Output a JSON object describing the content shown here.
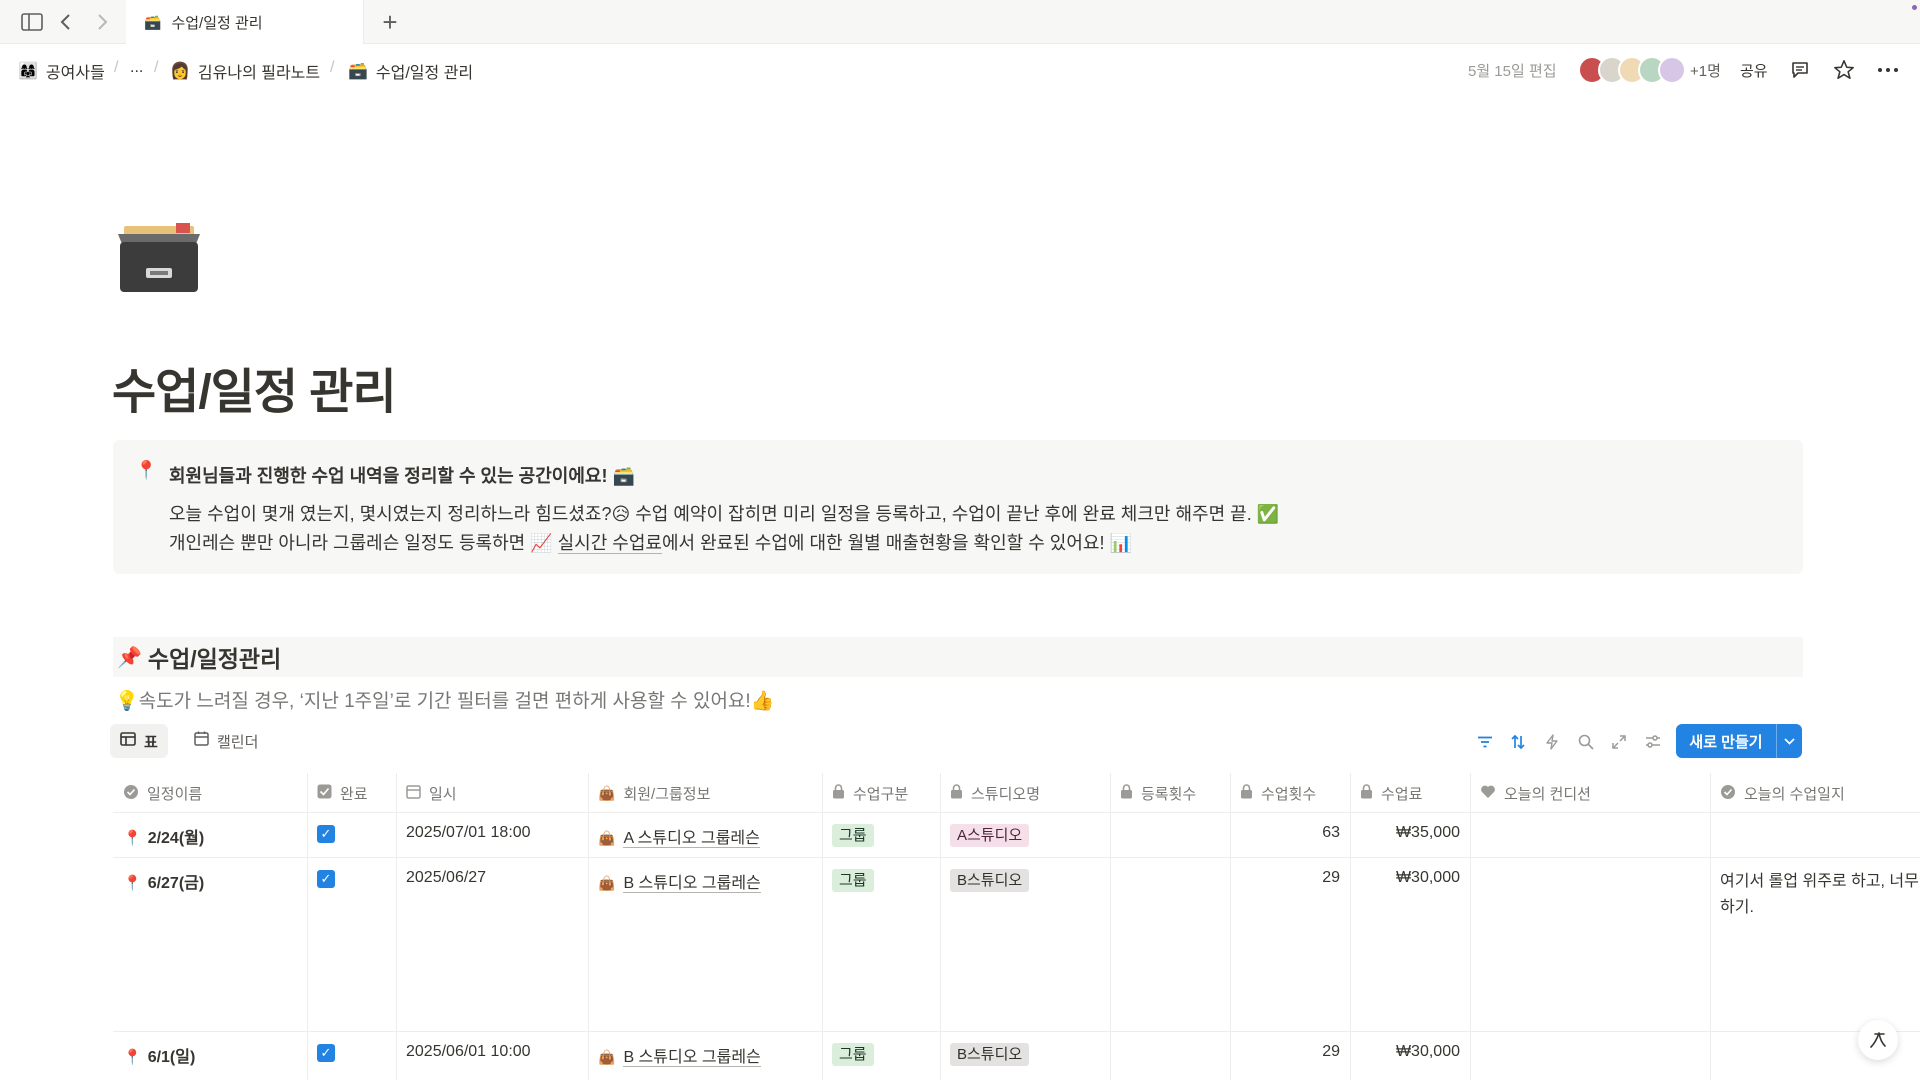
{
  "tabbar": {
    "tab_title": "수업/일정 관리",
    "tab_icon": "card-index-icon"
  },
  "breadcrumb": {
    "items": [
      "공여사들",
      "...",
      "김유나의 필라노트",
      "수업/일정 관리"
    ],
    "separator": "/"
  },
  "topbar": {
    "edited": "5월 15일 편집",
    "more_users": "+1명",
    "share": "공유"
  },
  "page": {
    "title": "수업/일정 관리",
    "icon": "card-file-box-icon"
  },
  "callout": {
    "line1": "회원님들과 진행한 수업 내역을 정리할 수 있는 공간이에요! 🗃️",
    "line2": "오늘 수업이 몇개 였는지, 몇시였는지 정리하느라 힘드셨죠?😥 수업 예약이 잡히면 미리 일정을 등록하고, 수업이 끝난 후에 완료 체크만 해주면 끝. ✅",
    "line3_prefix": "개인레슨 뿐만 아니라 그룹레슨 일정도 등록하면 📈 ",
    "line3_link": "실시간 수업료",
    "line3_suffix": "에서 완료된 수업에 대한 월별 매출현황을 확인할 수 있어요! 📊"
  },
  "section": {
    "heading": "수업/일정관리",
    "tip": "💡속도가 느려질 경우, ‘지난 1주일’로 기간 필터를 걸면 편하게 사용할 수 있어요!👍"
  },
  "views": {
    "table": "표",
    "calendar": "캘린더",
    "new_button": "새로 만들기"
  },
  "table": {
    "columns": [
      "일정이름",
      "완료",
      "일시",
      "회원/그룹정보",
      "수업구분",
      "스튜디오명",
      "등록횟수",
      "수업횟수",
      "수업료",
      "오늘의 컨디션",
      "오늘의 수업일지"
    ],
    "rows": [
      {
        "name": "2/24(월)",
        "done": true,
        "datetime": "2025/07/01 18:00",
        "member": "A 스튜디오 그룹레슨",
        "type": "그룹",
        "studio": "A스튜디오",
        "studio_color": "pink",
        "registered": "",
        "count": "63",
        "fee": "₩35,000",
        "condition": "",
        "journal": ""
      },
      {
        "name": "6/27(금)",
        "done": true,
        "datetime": "2025/06/27",
        "member": "B 스튜디오 그룹레슨",
        "type": "그룹",
        "studio": "B스튜디오",
        "studio_color": "gray",
        "registered": "",
        "count": "29",
        "fee": "₩30,000",
        "condition": "",
        "journal": "여기서 롤업 위주로 하고, 너무 하기."
      },
      {
        "name": "6/1(일)",
        "done": true,
        "datetime": "2025/06/01 10:00",
        "member": "B 스튜디오 그룹레슨",
        "type": "그룹",
        "studio": "B스튜디오",
        "studio_color": "gray",
        "registered": "",
        "count": "29",
        "fee": "₩30,000",
        "condition": "",
        "journal": ""
      }
    ]
  },
  "colors": {
    "accent": "#2383e2",
    "pin_red": "#d44c47",
    "tag_green": "#dbeddb",
    "tag_pink": "#f5e0e9",
    "tag_gray": "#e3e2e0"
  }
}
